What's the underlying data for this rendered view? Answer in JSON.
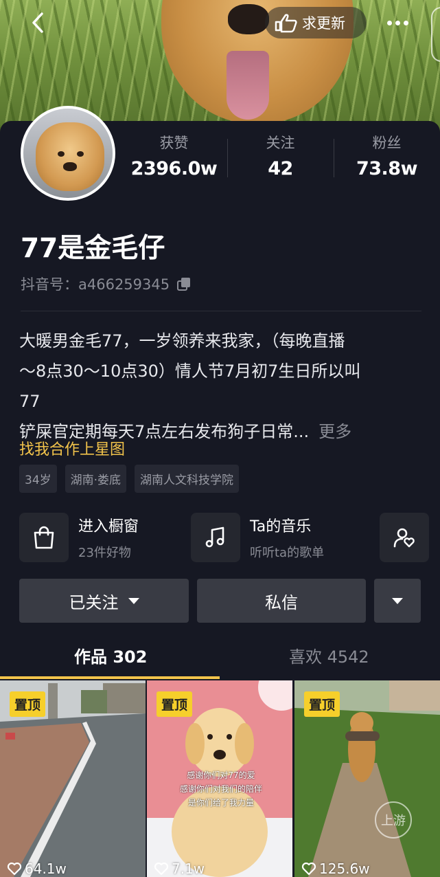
{
  "header": {
    "request_update_label": "求更新"
  },
  "profile": {
    "nickname": "77是金毛仔",
    "douyin_id": "抖音号：a466259345",
    "stats": [
      {
        "label": "获赞",
        "value": "2396.0w"
      },
      {
        "label": "关注",
        "value": "42"
      },
      {
        "label": "粉丝",
        "value": "73.8w"
      }
    ],
    "bio_lines": [
      "大暖男金毛77，一岁领养来我家，（每晚直播",
      "～8点30～10点30）情人节7月初7生日所以叫",
      "77",
      "铲屎官定期每天7点左右发布狗子日常..."
    ],
    "bio_more": "更多",
    "star_link": "找我合作上星图",
    "tags": [
      "34岁",
      "湖南·娄底",
      "湖南人文科技学院"
    ]
  },
  "shortcuts": [
    {
      "title": "进入橱窗",
      "subtitle": "23件好物",
      "icon": "shopping-bag-icon"
    },
    {
      "title": "Ta的音乐",
      "subtitle": "听听ta的歌单",
      "icon": "music-note-icon"
    },
    {
      "icon": "user-heart-icon"
    }
  ],
  "actions": {
    "followed_label": "已关注",
    "message_label": "私信"
  },
  "tabs": [
    {
      "label": "作品 302",
      "active": true
    },
    {
      "label": "喜欢 4542",
      "active": false
    }
  ],
  "videos": [
    {
      "pinned_label": "置顶",
      "likes": "64.1w"
    },
    {
      "pinned_label": "置顶",
      "likes": "7.1w",
      "caption": [
        "感谢你们对77的爱",
        "感谢你们对我们的陪伴",
        "是你们给了我力量"
      ]
    },
    {
      "pinned_label": "置顶",
      "likes": "125.6w"
    }
  ],
  "watermark": "上游",
  "colors": {
    "background": "#161823",
    "accent": "#f3c44b",
    "pin_badge": "#f6cf2b",
    "button": "#393b44"
  }
}
